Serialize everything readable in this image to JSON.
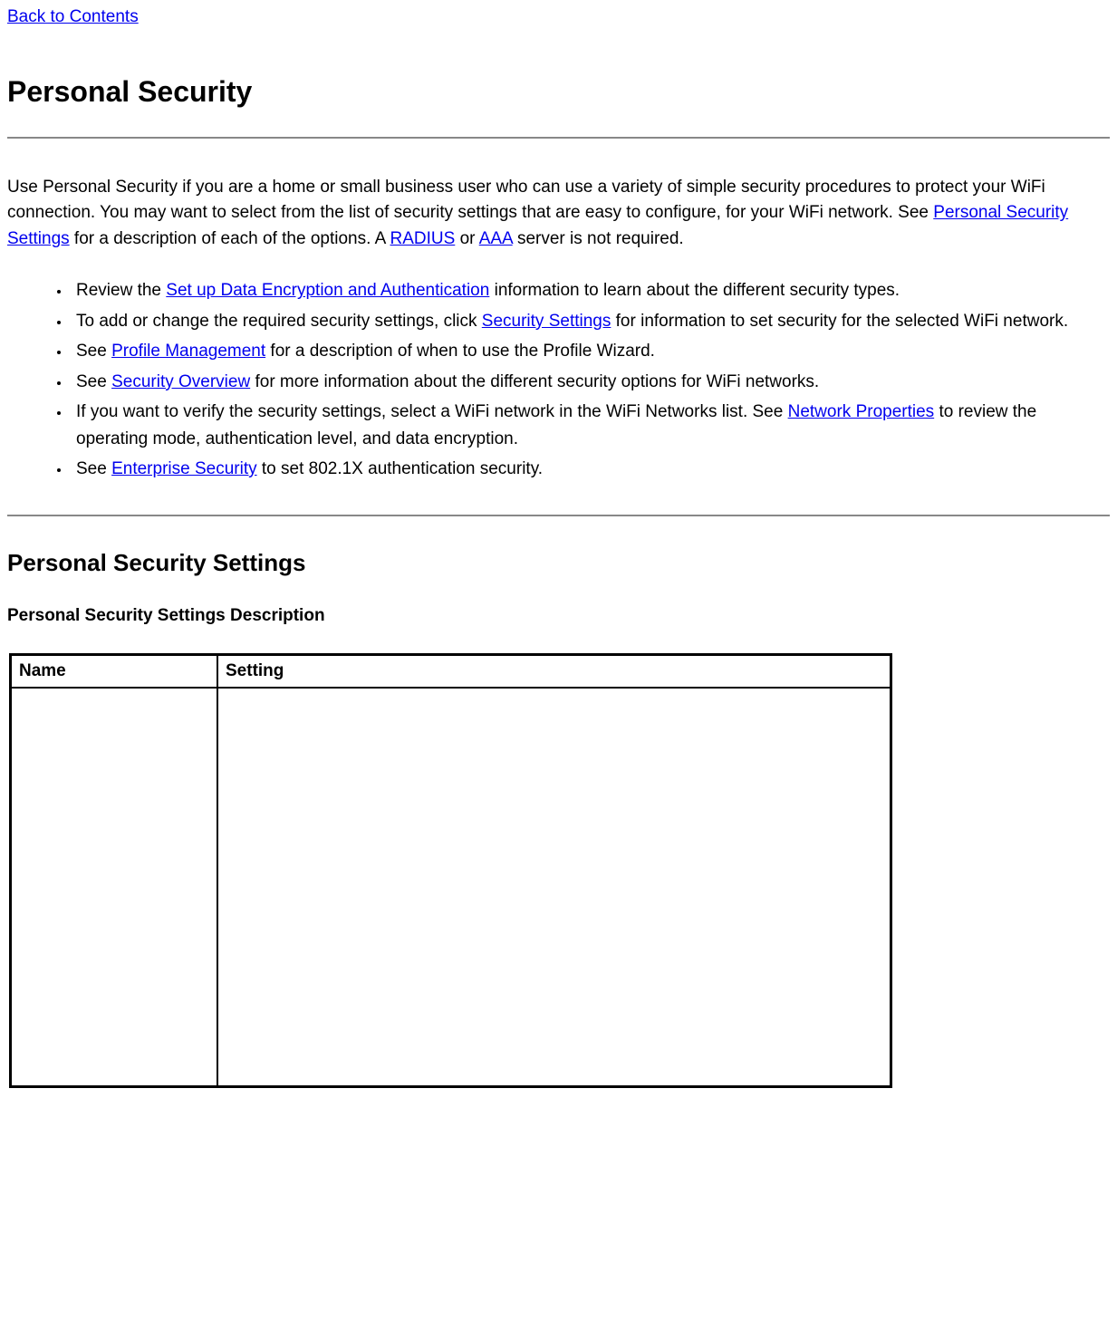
{
  "topLink": "Back to Contents",
  "h1": "Personal Security",
  "intro": {
    "t1": "Use Personal Security if you are a home or small business user who can use a variety of simple security procedures to protect your WiFi connection. You may want to select from the list of security settings that are easy to configure, for your WiFi network. See ",
    "link1": "Personal Security Settings",
    "t2": " for a description of each of the options. A ",
    "link2": "RADIUS",
    "t3": " or ",
    "link3": "AAA",
    "t4": " server is not required."
  },
  "bullets": [
    {
      "parts": [
        {
          "text": "Review the "
        },
        {
          "link": "Set up Data Encryption and Authentication"
        },
        {
          "text": " information to learn about the different security types."
        }
      ]
    },
    {
      "parts": [
        {
          "text": "To add or change the required security settings, click "
        },
        {
          "link": "Security Settings"
        },
        {
          "text": " for information to set security for the selected WiFi network."
        }
      ]
    },
    {
      "parts": [
        {
          "text": "See "
        },
        {
          "link": "Profile Management"
        },
        {
          "text": " for a description of when to use the Profile Wizard."
        }
      ]
    },
    {
      "parts": [
        {
          "text": "See "
        },
        {
          "link": "Security Overview"
        },
        {
          "text": " for more information about the different security options for WiFi networks."
        }
      ]
    },
    {
      "parts": [
        {
          "text": "If you want to verify the security settings, select a WiFi network in the WiFi Networks list. See "
        },
        {
          "link": "Network Properties"
        },
        {
          "text": " to review the operating mode, authentication level, and data encryption."
        }
      ]
    },
    {
      "parts": [
        {
          "text": "See "
        },
        {
          "link": "Enterprise Security"
        },
        {
          "text": " to set 802.1X authentication security."
        }
      ]
    }
  ],
  "h2": "Personal Security Settings",
  "h3": "Personal Security Settings Description",
  "table": {
    "headers": [
      "Name",
      "Setting"
    ]
  }
}
